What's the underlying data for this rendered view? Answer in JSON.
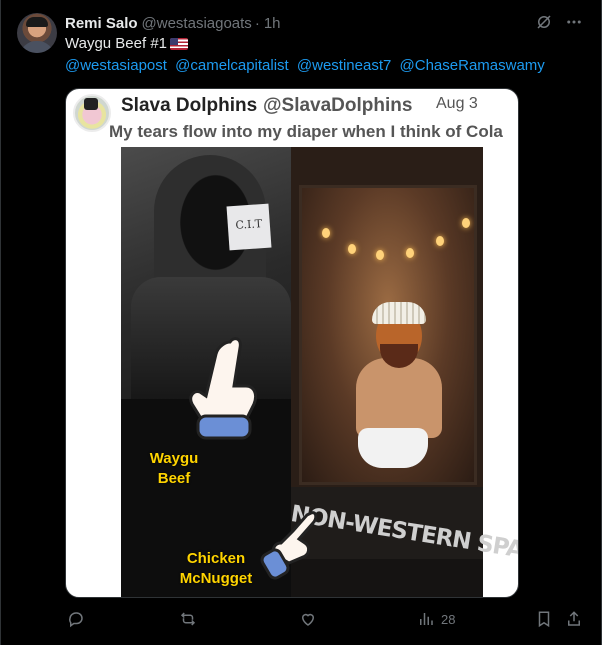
{
  "post": {
    "author_name": "Remi Salo",
    "author_handle": "@westasiagoats",
    "separator": "·",
    "time": "1h",
    "text": "Waygu Beef #1",
    "flag_icon": "us-flag-emoji",
    "mentions": [
      "@westasiapost",
      "@camelcapitalist",
      "@westineast7",
      "@ChaseRamaswamy"
    ]
  },
  "quoted": {
    "name": "Slava Dolphins",
    "handle": "@SlavaDolphins",
    "date": "Aug 3",
    "text": "My tears flow into my diaper when I think of Cola",
    "paper_scribble": "C.I.T",
    "sign_text": "NON-WESTERN SPACE",
    "caption_left": "Waygu\nBeef",
    "caption_bottom": "Chicken\nMcNugget"
  },
  "actions": {
    "views": "28",
    "icons": [
      "reply-icon",
      "repost-icon",
      "like-icon",
      "views-icon",
      "bookmark-icon",
      "share-icon"
    ]
  },
  "header_icons": [
    "grok-icon",
    "more-icon"
  ],
  "colors": {
    "background": "#000000",
    "text_primary": "#e7e9ea",
    "text_secondary": "#71767b",
    "link": "#1d9bf0",
    "caption_yellow": "#ffd400"
  }
}
